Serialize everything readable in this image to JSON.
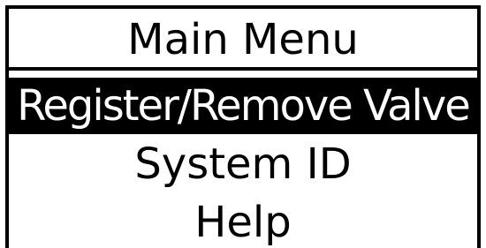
{
  "screen": {
    "title": "Main Menu",
    "menu_items": [
      {
        "label": "Register/Remove Valve",
        "selected": true
      },
      {
        "label": "System ID",
        "selected": false
      },
      {
        "label": "Help",
        "selected": false
      }
    ]
  },
  "colors": {
    "background": "#ffffff",
    "foreground": "#000000",
    "highlight_background": "#000000",
    "highlight_text": "#ffffff"
  }
}
